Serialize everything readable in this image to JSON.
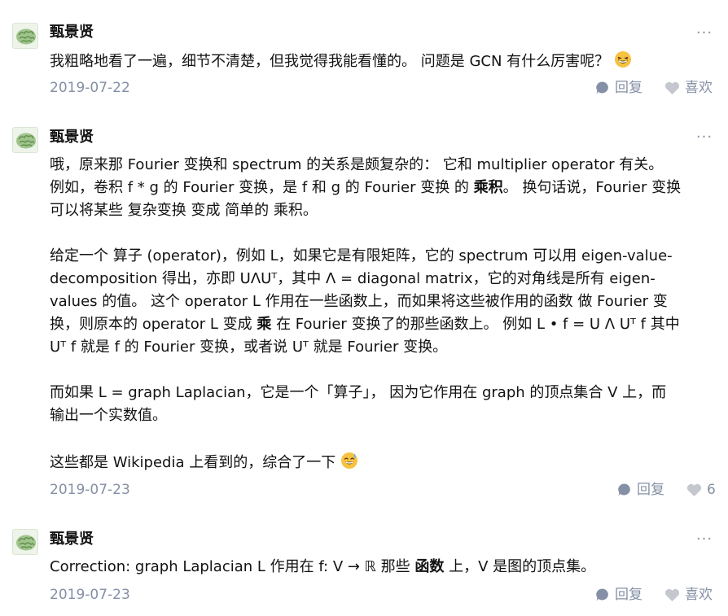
{
  "comments": [
    {
      "author": "甄景贤",
      "more": "···",
      "lines": [
        [
          "我粗略地看了一遍，细节不清楚，但我觉得我能看懂的。 问题是 GCN 有什么厉害呢？",
          "grin-emoji"
        ]
      ],
      "date": "2019-07-22",
      "reply_label": "回复",
      "like_label": "喜欢"
    },
    {
      "author": "甄景贤",
      "more": "···",
      "lines": {
        "l1": "哦，原来那 Fourier 变换和 spectrum 的关系是颇复杂的： 它和 multiplier operator 有关。",
        "l2a": "例如，卷积 f * g 的 Fourier 变换，是 f 和 g 的 Fourier 变换 的 ",
        "l2b": "乘积",
        "l2c": "。 换句话说，Fourier 变换",
        "l3": "可以将某些 复杂变换 变成 简单的 乘积。",
        "l4": "给定一个 算子 (operator)，例如 L，如果它是有限矩阵，它的 spectrum 可以用 eigen-value-",
        "l5": "decomposition 得出，亦即 UΛUᵀ，其中 Λ = diagonal matrix，它的对角线是所有 eigen-",
        "l6": "values 的值。 这个 operator L 作用在一些函数上，而如果将这些被作用的函数 做 Fourier 变",
        "l7a": "换，则原本的 operator L 变成 ",
        "l7b": "乘",
        "l7c": " 在 Fourier 变换了的那些函数上。 例如 L • f = U Λ Uᵀ f 其中",
        "l8": "Uᵀ f 就是 f 的 Fourier 变换，或者说 Uᵀ 就是 Fourier 变换。",
        "l9": "而如果 L = graph Laplacian，它是一个「算子」， 因为它作用在 graph 的顶点集合 V 上，而",
        "l10": "输出一个实数值。",
        "l11": "这些都是 Wikipedia 上看到的，综合了一下"
      },
      "date": "2019-07-23",
      "reply_label": "回复",
      "like_count": "6"
    },
    {
      "author": "甄景贤",
      "more": "···",
      "lines": {
        "l1a": "Correction: graph Laplacian L 作用在 f: V → ℝ 那些 ",
        "l1b": "函数",
        "l1c": " 上，V 是图的顶点集。"
      },
      "date": "2019-07-23",
      "reply_label": "回复",
      "like_label": "喜欢"
    }
  ],
  "colors": {
    "text": "#121212",
    "meta": "#8590a6",
    "icon": "#8590a6",
    "heart": "#c4c7ce"
  }
}
